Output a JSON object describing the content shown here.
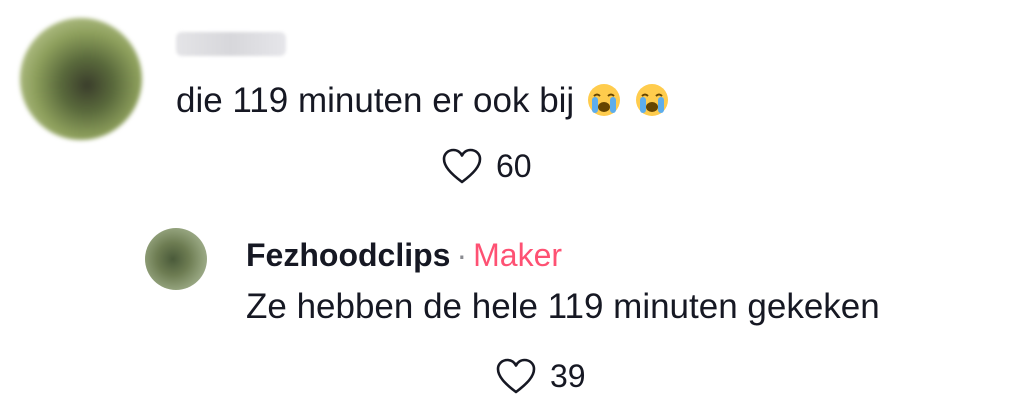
{
  "top_comment": {
    "text": "die 119 minuten er ook bij",
    "emojis": [
      "loudly-crying-face",
      "loudly-crying-face"
    ],
    "like_count": "60"
  },
  "reply": {
    "username": "Fezhoodclips",
    "separator": "·",
    "badge": "Maker",
    "text": "Ze hebben de hele 119 minuten gekeken",
    "like_count": "39"
  },
  "colors": {
    "text": "#161823",
    "badge": "#fe2c55",
    "muted": "#8a8b91"
  }
}
